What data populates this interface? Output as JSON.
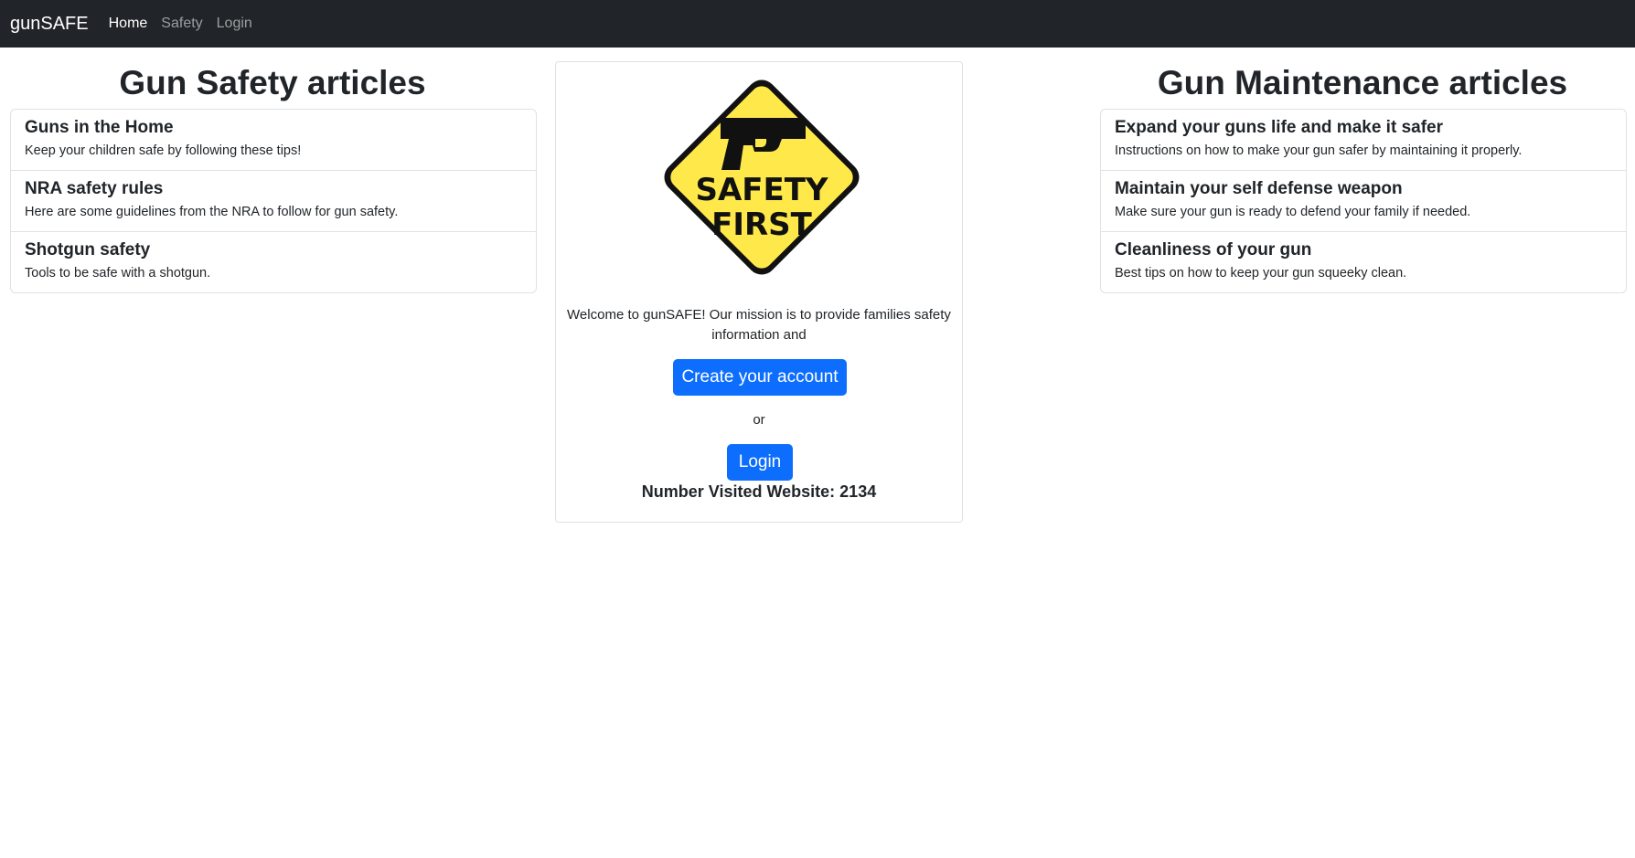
{
  "nav": {
    "brand": "gunSAFE",
    "links": [
      {
        "label": "Home",
        "active": true
      },
      {
        "label": "Safety",
        "active": false
      },
      {
        "label": "Login",
        "active": false
      }
    ]
  },
  "safety": {
    "heading": "Gun Safety articles",
    "items": [
      {
        "title": "Guns in the Home",
        "text": "Keep your children safe by following these tips!"
      },
      {
        "title": "NRA safety rules",
        "text": "Here are some guidelines from the NRA to follow for gun safety."
      },
      {
        "title": "Shotgun safety",
        "text": "Tools to be safe with a shotgun."
      }
    ]
  },
  "maintenance": {
    "heading": "Gun Maintenance articles",
    "items": [
      {
        "title": "Expand your guns life and make it safer",
        "text": "Instructions on how to make your gun safer by maintaining it properly."
      },
      {
        "title": "Maintain your self defense weapon",
        "text": "Make sure your gun is ready to defend your family if needed."
      },
      {
        "title": "Cleanliness of your gun",
        "text": "Best tips on how to keep your gun squeeky clean."
      }
    ]
  },
  "center": {
    "sign_line1": "SAFETY",
    "sign_line2": "FIRST",
    "welcome": "Welcome to gunSAFE! Our mission is to provide families safety information and",
    "create_button": "Create your account",
    "or": "or",
    "login_button": "Login",
    "visits": "Number Visited Website: 2134"
  },
  "colors": {
    "navbar": "#212529",
    "primary": "#0d6efd",
    "sign_yellow": "#ffe94a"
  },
  "icons": {
    "sign": "safety-first-sign-icon",
    "pistol": "pistol-icon"
  }
}
